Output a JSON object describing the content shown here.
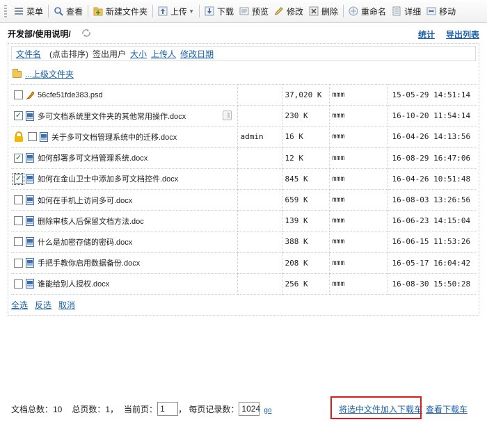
{
  "toolbar": {
    "menu": "菜单",
    "view": "查看",
    "new_folder": "新建文件夹",
    "upload": "上传",
    "download": "下载",
    "preview": "预览",
    "modify": "修改",
    "delete": "删除",
    "rename": "重命名",
    "detail": "详细",
    "move": "移动"
  },
  "path": {
    "current": "开发部/使用说明/",
    "stats": "统计",
    "export": "导出列表"
  },
  "sortbar": {
    "filename": "文件名",
    "click_sort": "(点击排序)",
    "checkout_user": "签出用户",
    "size": "大小",
    "uploader": "上传人",
    "modified": "修改日期"
  },
  "parent_folder": "...上级文件夹",
  "files": [
    {
      "name": "56cfe51fde383.psd",
      "icon": "psd-icon",
      "checked": false,
      "locked": false,
      "user": "",
      "size": "37,020 K",
      "uploader": "mmm",
      "date": "15-05-29 14:51:14"
    },
    {
      "name": "多可文档系统里文件夹的其他常用操作.docx",
      "icon": "docx-icon",
      "checked": true,
      "locked": false,
      "user": "",
      "size": "230 K",
      "uploader": "mmm",
      "date": "16-10-20 11:54:14"
    },
    {
      "name": "关于多可文档管理系统中的迁移.docx",
      "icon": "docx-icon",
      "checked": false,
      "locked": true,
      "user": "admin",
      "size": "16 K",
      "uploader": "mmm",
      "date": "16-04-26 14:13:56"
    },
    {
      "name": "如何部署多可文档管理系统.docx",
      "icon": "docx-icon",
      "checked": true,
      "locked": false,
      "user": "",
      "size": "12 K",
      "uploader": "mmm",
      "date": "16-08-29 16:47:06"
    },
    {
      "name": "如何在金山卫士中添加多可文档控件.docx",
      "icon": "docx-icon",
      "checked": true,
      "locked": false,
      "user": "",
      "size": "845 K",
      "uploader": "mmm",
      "date": "16-04-26 10:51:48"
    },
    {
      "name": "如何在手机上访问多可.docx",
      "icon": "docx-icon",
      "checked": false,
      "locked": false,
      "user": "",
      "size": "659 K",
      "uploader": "mmm",
      "date": "16-08-03 13:26:56"
    },
    {
      "name": "删除审核人后保留文档方法.doc",
      "icon": "docx-icon",
      "checked": false,
      "locked": false,
      "user": "",
      "size": "139 K",
      "uploader": "mmm",
      "date": "16-06-23 14:15:04"
    },
    {
      "name": "什么是加密存储的密码.docx",
      "icon": "docx-icon",
      "checked": false,
      "locked": false,
      "user": "",
      "size": "388 K",
      "uploader": "mmm",
      "date": "16-06-15 11:53:26"
    },
    {
      "name": "手把手教你启用数据备份.docx",
      "icon": "docx-icon",
      "checked": false,
      "locked": false,
      "user": "",
      "size": "208 K",
      "uploader": "mmm",
      "date": "16-05-17 16:04:42"
    },
    {
      "name": "谁能给别人授权.docx",
      "icon": "docx-icon",
      "checked": false,
      "locked": false,
      "user": "",
      "size": "256 K",
      "uploader": "mmm",
      "date": "16-08-30 15:50:28"
    }
  ],
  "selection": {
    "select_all": "全选",
    "invert": "反选",
    "cancel": "取消"
  },
  "pager": {
    "total_label": "文档总数：10",
    "pages_label": "总页数：1，",
    "current_label": "当前页：",
    "current_value": "1",
    "per_page_label": "，  每页记录数：",
    "per_page_value": "1024",
    "go": "go"
  },
  "cart": {
    "add": "将选中文件加入下载车",
    "view": "查看下载车"
  }
}
